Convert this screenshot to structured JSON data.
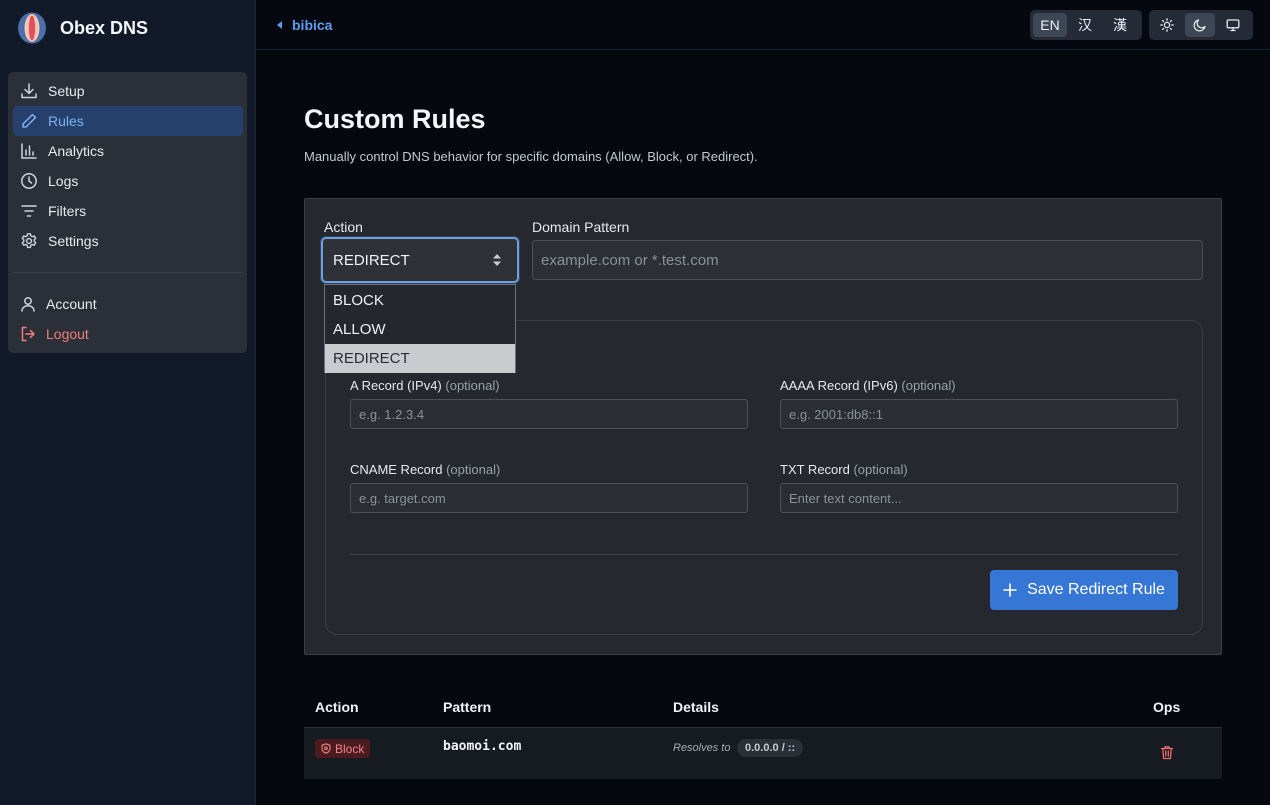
{
  "brand": {
    "name": "Obex DNS",
    "logo_icon": "obex-logo-icon"
  },
  "sidebar": {
    "items": [
      {
        "label": "Setup",
        "icon": "download-icon",
        "active": false
      },
      {
        "label": "Rules",
        "icon": "pencil-icon",
        "active": true
      },
      {
        "label": "Analytics",
        "icon": "bar-chart-icon",
        "active": false
      },
      {
        "label": "Logs",
        "icon": "clock-icon",
        "active": false
      },
      {
        "label": "Filters",
        "icon": "filter-icon",
        "active": false
      },
      {
        "label": "Settings",
        "icon": "gear-icon",
        "active": false
      }
    ],
    "account_label": "Account",
    "logout_label": "Logout"
  },
  "topbar": {
    "back_label": "bibica",
    "languages": [
      "EN",
      "汉",
      "漢"
    ],
    "active_language": "EN",
    "themes": [
      "sun-icon",
      "moon-icon",
      "monitor-icon"
    ],
    "active_theme": "moon-icon"
  },
  "page": {
    "title": "Custom Rules",
    "subtitle": "Manually control DNS behavior for specific domains (Allow, Block, or Redirect)."
  },
  "form": {
    "action_label": "Action",
    "action_value": "REDIRECT",
    "action_options": [
      "BLOCK",
      "ALLOW",
      "REDIRECT"
    ],
    "domain_label": "Domain Pattern",
    "domain_placeholder": "example.com or *.test.com",
    "fields": {
      "a_label": "A Record (IPv4)",
      "a_placeholder": "e.g. 1.2.3.4",
      "aaaa_label": "AAAA Record (IPv6)",
      "aaaa_placeholder": "e.g. 2001:db8::1",
      "cname_label": "CNAME Record",
      "cname_placeholder": "e.g. target.com",
      "txt_label": "TXT Record",
      "txt_placeholder": "Enter text content...",
      "optional": "(optional)"
    },
    "save_label": "Save Redirect Rule"
  },
  "table": {
    "headers": {
      "action": "Action",
      "pattern": "Pattern",
      "details": "Details",
      "ops": "Ops"
    },
    "rows": [
      {
        "action": "Block",
        "pattern": "baomoi.com",
        "resolves_label": "Resolves to",
        "resolves_value": "0.0.0.0 / ::"
      }
    ]
  },
  "colors": {
    "accent": "#3677d6",
    "active_nav_text": "#7eb2f5",
    "danger": "#ef7d7d",
    "background": "#05080f"
  }
}
